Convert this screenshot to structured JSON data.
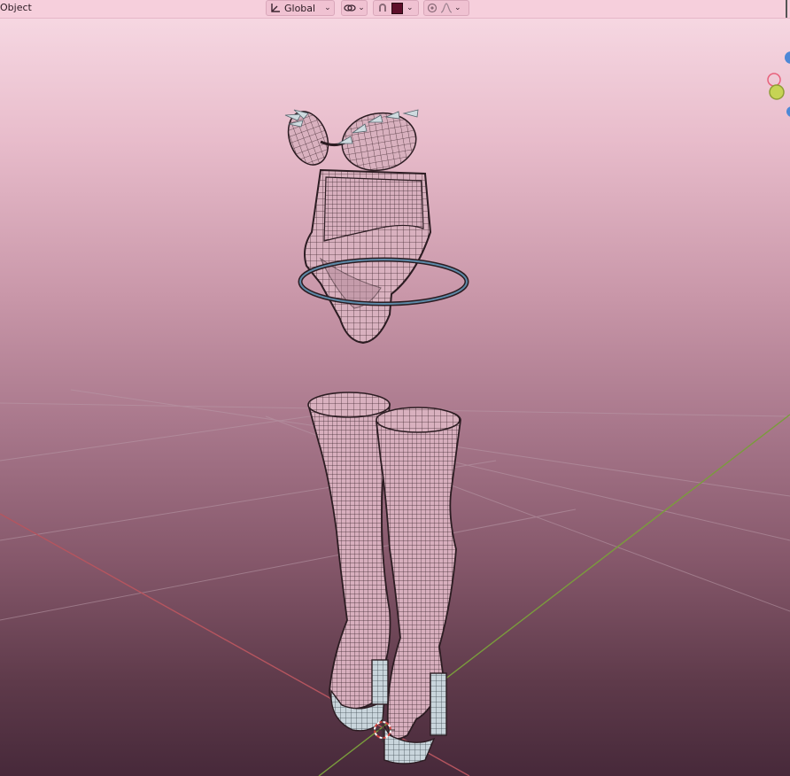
{
  "header": {
    "mode_label": "Object",
    "orientation": "Global",
    "icons": {
      "orientation": "transform-orientation-icon",
      "pivot": "snap-link-icon",
      "proportional": "proportional-edit-icon",
      "falloff": "falloff-curve-icon"
    },
    "color_swatch": "#5e0f2a"
  },
  "gizmo": {
    "x_color": "#e8617c",
    "y_color": "#b7c94d",
    "z_color": "#4d88d6"
  },
  "axes": {
    "x_color": "#b5555f",
    "y_color": "#7a9c3c"
  }
}
